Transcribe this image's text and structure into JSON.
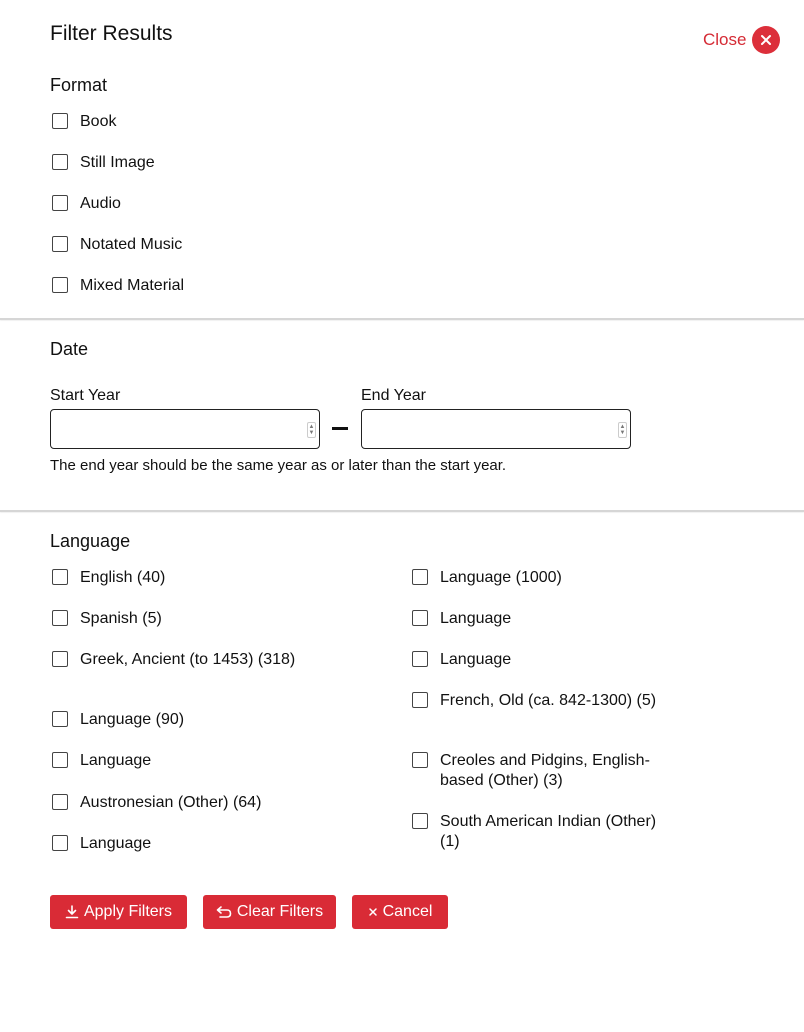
{
  "header": {
    "title": "Filter Results",
    "close_label": "Close"
  },
  "format": {
    "heading": "Format",
    "options": [
      "Book",
      "Still Image",
      "Audio",
      "Notated Music",
      "Mixed Material"
    ]
  },
  "date": {
    "heading": "Date",
    "start_label": "Start Year",
    "end_label": "End Year",
    "start_value": "",
    "end_value": "",
    "helper_text": "The end year should be the same year as or later than the start year."
  },
  "language": {
    "heading": "Language",
    "left_column": [
      "English (40)",
      "Spanish (5)",
      "Greek, Ancient (to 1453) (318)",
      "Language (90)",
      "Language",
      "Austronesian (Other) (64)",
      "Language"
    ],
    "right_column": [
      "Language (1000)",
      "Language",
      "Language",
      "French, Old (ca. 842-1300) (5)",
      "Creoles and Pidgins, English-based (Other) (3)",
      "South American Indian (Other) (1)"
    ]
  },
  "actions": {
    "apply_label": "Apply Filters",
    "clear_label": "Clear Filters",
    "cancel_label": "Cancel"
  },
  "colors": {
    "accent": "#dc2f3a",
    "divider": "#d6d6d6"
  }
}
